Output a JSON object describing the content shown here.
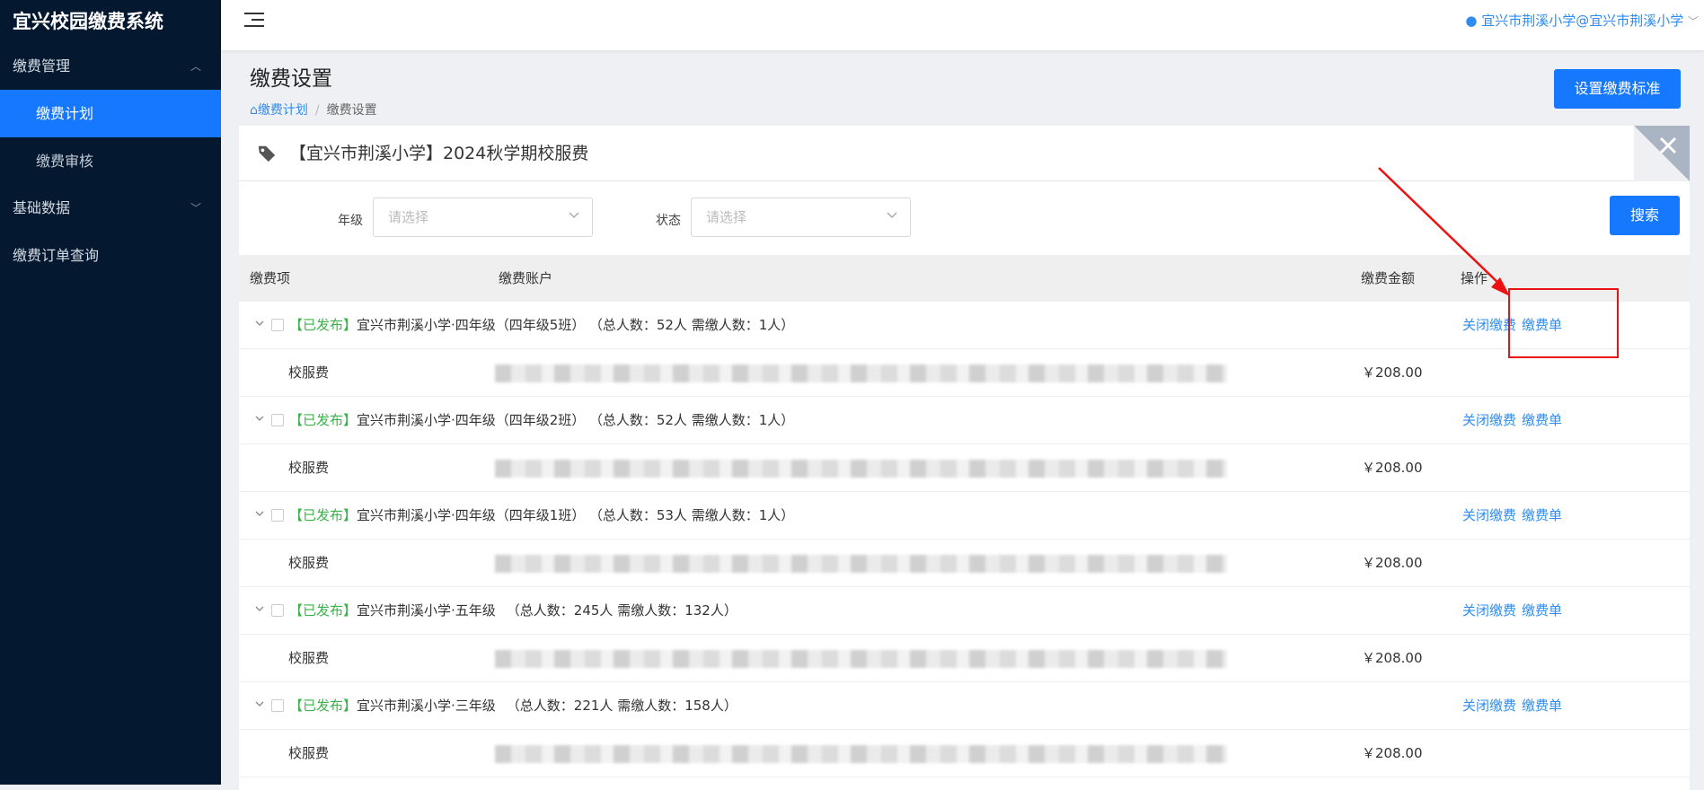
{
  "app": {
    "title": "宜兴校园缴费系统"
  },
  "sidebar": {
    "groups": [
      {
        "label": "缴费管理",
        "items": [
          {
            "label": "缴费计划"
          },
          {
            "label": "缴费审核"
          }
        ]
      },
      {
        "label": "基础数据"
      }
    ],
    "plain": [
      {
        "label": "缴费订单查询"
      }
    ]
  },
  "topbar": {
    "user": "宜兴市荆溪小学@宜兴市荆溪小学"
  },
  "page": {
    "title": "缴费设置",
    "breadcrumb": {
      "home": "缴费计划",
      "current": "缴费设置"
    },
    "set_standard_button": "设置缴费标准"
  },
  "plan": {
    "title": "【宜兴市荆溪小学】2024秋学期校服费"
  },
  "filters": {
    "grade_label": "年级",
    "grade_placeholder": "请选择",
    "status_label": "状态",
    "status_placeholder": "请选择",
    "search_button": "搜索"
  },
  "table": {
    "headers": {
      "item": "缴费项",
      "account": "缴费账户",
      "amount": "缴费金额",
      "ops": "操作"
    },
    "groups": [
      {
        "status": "【已发布】",
        "name": "宜兴市荆溪小学·四年级（四年级5班）",
        "counts": "（总人数：52人 需缴人数：1人）",
        "fee": "校服费",
        "amount": "￥208.00"
      },
      {
        "status": "【已发布】",
        "name": "宜兴市荆溪小学·四年级（四年级2班）",
        "counts": "（总人数：52人 需缴人数：1人）",
        "fee": "校服费",
        "amount": "￥208.00"
      },
      {
        "status": "【已发布】",
        "name": "宜兴市荆溪小学·四年级（四年级1班）",
        "counts": "（总人数：53人 需缴人数：1人）",
        "fee": "校服费",
        "amount": "￥208.00"
      },
      {
        "status": "【已发布】",
        "name": "宜兴市荆溪小学·五年级",
        "counts": "（总人数：245人 需缴人数：132人）",
        "fee": "校服费",
        "amount": "￥208.00"
      },
      {
        "status": "【已发布】",
        "name": "宜兴市荆溪小学·三年级",
        "counts": "（总人数：221人 需缴人数：158人）",
        "fee": "校服费",
        "amount": "￥208.00"
      }
    ],
    "op_close": "关闭缴费",
    "op_bill": "缴费单"
  },
  "colors": {
    "accent": "#1677ff",
    "sidebar_bg": "#04182f",
    "published": "#3cb34a",
    "annotation": "#ee1111"
  }
}
